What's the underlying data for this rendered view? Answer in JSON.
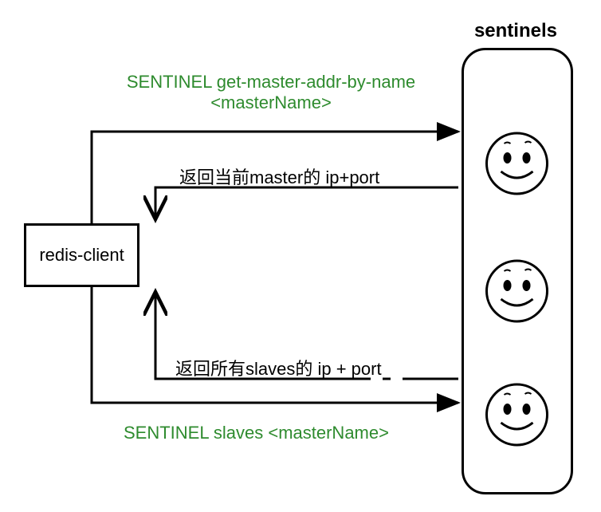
{
  "title": "sentinels",
  "client_label": "redis-client",
  "commands": {
    "get_master": "SENTINEL get-master-addr-by-name <masterName>",
    "slaves": "SENTINEL slaves <masterName>"
  },
  "responses": {
    "master_ip_port": "返回当前master的 ip+port",
    "slaves_ip_port": "返回所有slaves的 ip + port"
  },
  "sentinel_count": 3
}
